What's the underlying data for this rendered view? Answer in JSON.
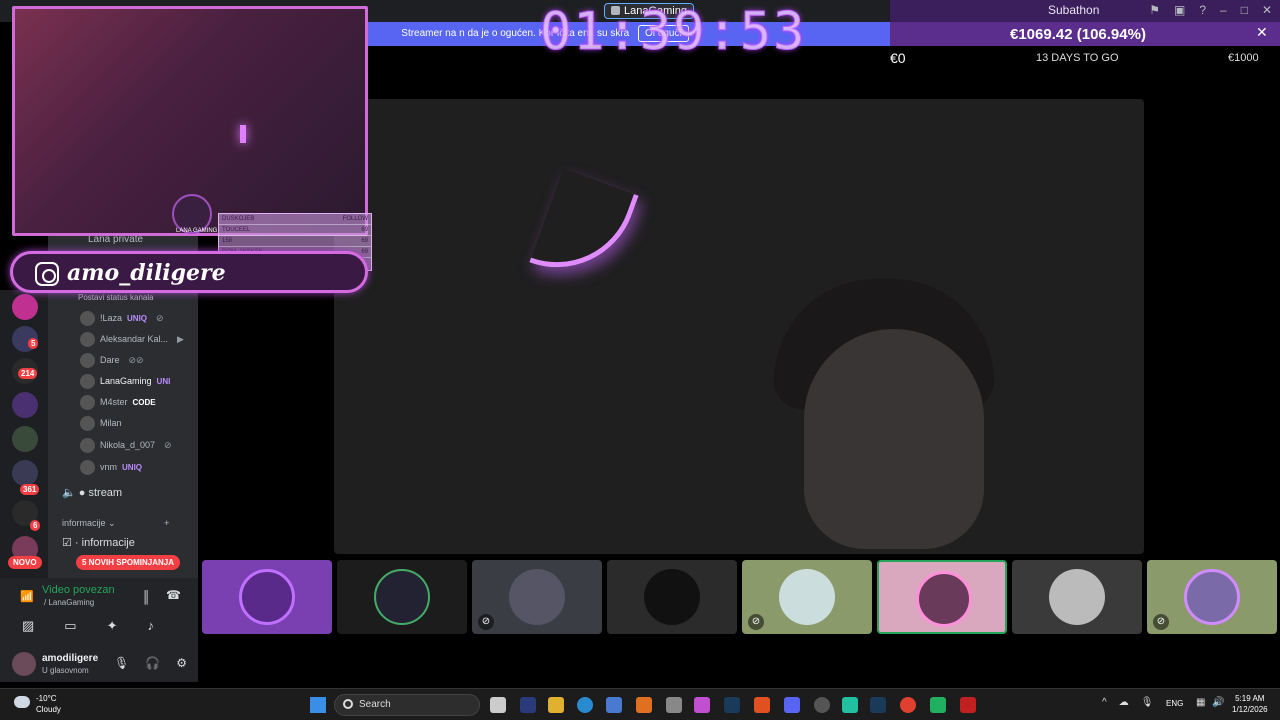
{
  "window": {
    "title": "LanaGaming",
    "help_icon": "?",
    "minimize_icon": "–",
    "maximize_icon": "□",
    "close_icon": "✕"
  },
  "notice": {
    "text_before": "Streamer na",
    "text_mid": "n",
    "text_after": "da je o",
    "text_end": "ogućen. Kor",
    "text_tail": "ička",
    "text_last": "ena su skra",
    "dismiss_label": "Ol",
    "dismiss_label_tail": "oguči"
  },
  "subathon": {
    "title": "Subathon",
    "amount": "€1069.42 (106.94%)",
    "min": "€0",
    "days": "13 DAYS TO GO",
    "max": "€1000",
    "timer": "01:39:53"
  },
  "overlay": {
    "instagram_handle": "amo_diligere",
    "logo_text": "LANA GAMING",
    "follow_header": "DUSKOJEB",
    "follow_label": "FOLLOW",
    "follow_rows": [
      {
        "name": "TOUCEEL",
        "value": "69"
      },
      {
        "name": "158",
        "value": "69"
      },
      {
        "name": "DOM_1KSKSK",
        "value": "69"
      }
    ]
  },
  "channels": {
    "lana_private": "Lana private",
    "status_prompt": "Postavi status kanala",
    "members": [
      {
        "name": "!Laza",
        "tag": "UNIQ",
        "tag_color": "#b98cff"
      },
      {
        "name": "Aleksandar Kal...",
        "tag": "",
        "tag_color": ""
      },
      {
        "name": "Dare",
        "tag": "",
        "tag_color": ""
      },
      {
        "name": "LanaGaming",
        "tag": "UNI",
        "tag_color": "#b98cff"
      },
      {
        "name": "M4ster",
        "tag": "CODE",
        "tag_color": "#5fb0ff"
      },
      {
        "name": "Milan",
        "tag": "",
        "tag_color": ""
      },
      {
        "name": "Nikola_d_007",
        "tag": "",
        "tag_color": ""
      },
      {
        "name": "vnm",
        "tag": "UNIQ",
        "tag_color": "#b98cff"
      }
    ],
    "stream_label": "stream",
    "info_category": "informacije",
    "info_channel": "informacije",
    "novo_label": "NOVO",
    "mentions_label": "5 NOVIH SPOMINJANJA"
  },
  "servers": {
    "badges": [
      "5",
      "214",
      "361",
      "6"
    ]
  },
  "voice": {
    "status": "Video povezan",
    "channel": "/ LanaGaming",
    "username": "amodiligere",
    "user_status": "U glasovnom"
  },
  "taskbar": {
    "weather_temp": "-10°C",
    "weather_desc": "Cloudy",
    "search_placeholder": "Search",
    "lang": "ENG",
    "time": "5:19 AM",
    "date": "1/12/2026"
  },
  "colors": {
    "accent": "#5865f2",
    "subathon": "#5b2d8c",
    "overlay_glow": "#d06bd8"
  }
}
